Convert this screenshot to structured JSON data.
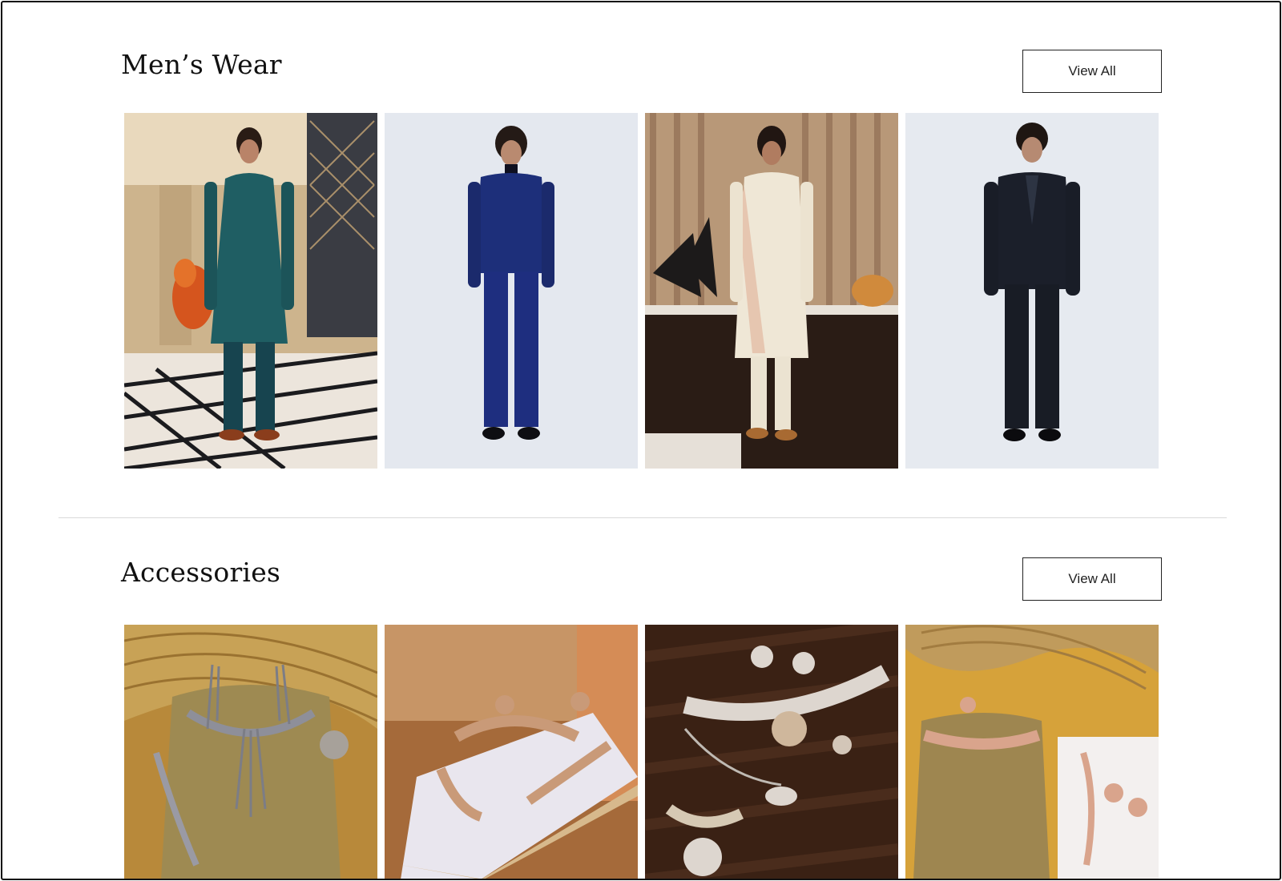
{
  "sections": [
    {
      "title": "Men’s Wear",
      "view_all_label": "View All",
      "products": [
        {
          "name": "teal-sherwani-set",
          "garment_color": "#1f5e63",
          "background": "interior"
        },
        {
          "name": "navy-bandhgala-set",
          "garment_color": "#1d2f7a",
          "background": "studio"
        },
        {
          "name": "ivory-sherwani-set",
          "garment_color": "#efe7d6",
          "background": "warm-interior"
        },
        {
          "name": "black-tuxedo-set",
          "garment_color": "#1b1f2a",
          "background": "studio"
        }
      ]
    },
    {
      "title": "Accessories",
      "view_all_label": "View All",
      "products": [
        {
          "name": "silver-pearl-choker-set",
          "metal_color": "#8e8f99",
          "background": "mustard-velvet"
        },
        {
          "name": "rose-gold-tiara-set",
          "metal_color": "#c99a78",
          "background": "wooden-box"
        },
        {
          "name": "crystal-choker-set",
          "metal_color": "#ddd6cf",
          "background": "dark-wood"
        },
        {
          "name": "rose-pearl-choker-set",
          "metal_color": "#d9a48c",
          "background": "mustard-velvet"
        }
      ]
    }
  ]
}
